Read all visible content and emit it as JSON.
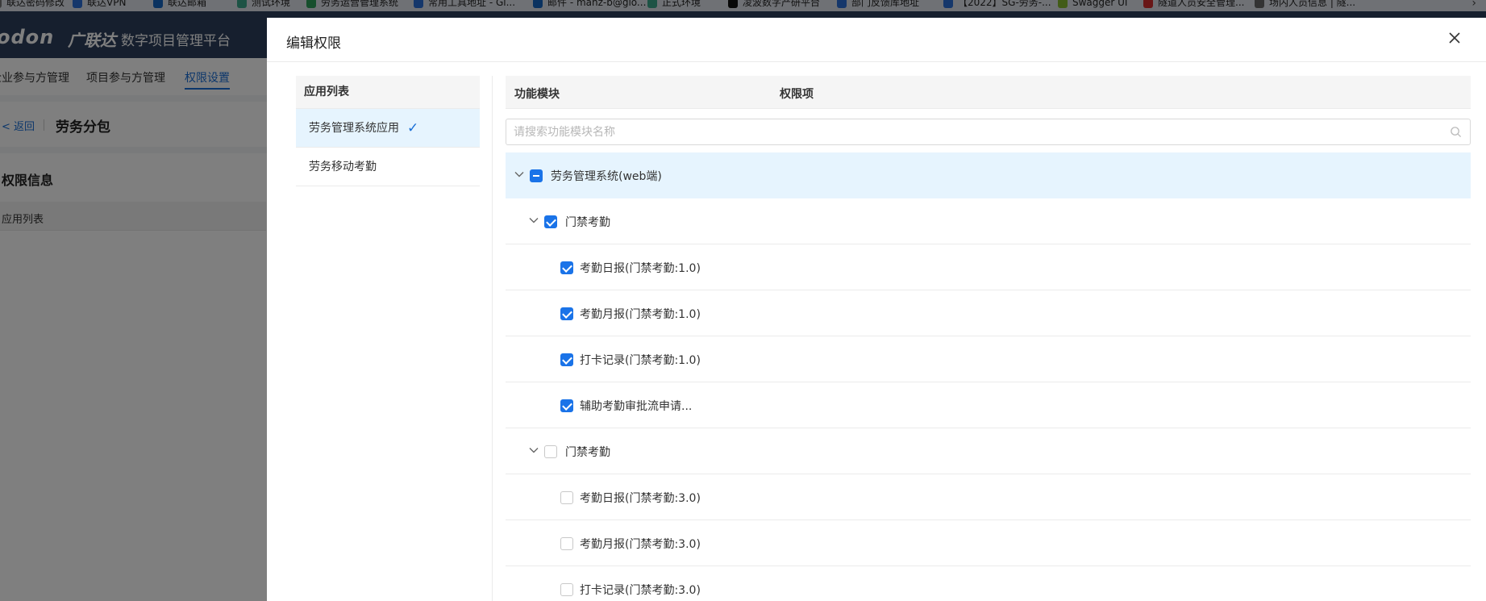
{
  "bookmarks": [
    {
      "label": "联达密码修改",
      "icon": "folder-icon",
      "color": "#777777"
    },
    {
      "label": "联达VPN",
      "icon": "cloud-icon",
      "color": "#2a6fd6"
    },
    {
      "label": "联达邮箱",
      "icon": "mail-icon",
      "color": "#1565c0"
    },
    {
      "label": "测试环境",
      "icon": "grid-icon",
      "color": "#3aa68a"
    },
    {
      "label": "劳务运营管理系统",
      "icon": "leaf-icon",
      "color": "#2e9e5b"
    },
    {
      "label": "常用工具地址 - Gi...",
      "icon": "link-icon",
      "color": "#2a6fd6"
    },
    {
      "label": "邮件 - mahz-b@glo...",
      "icon": "mail-icon",
      "color": "#1565c0"
    },
    {
      "label": "正式环境",
      "icon": "grid-icon",
      "color": "#3aa68a"
    },
    {
      "label": "凌波数字产研平台",
      "icon": "app-icon",
      "color": "#111111"
    },
    {
      "label": "部门反馈库地址",
      "icon": "dropbox-icon",
      "color": "#2a6fd6"
    },
    {
      "label": "【2022】SG-劳务-...",
      "icon": "shield-icon",
      "color": "#2a6fd6"
    },
    {
      "label": "Swagger UI",
      "icon": "swagger-icon",
      "color": "#85b92e"
    },
    {
      "label": "隧道人员安全管理...",
      "icon": "circle-icon",
      "color": "#d32f2f"
    },
    {
      "label": "场内人员信息 | 隧...",
      "icon": "doc-icon",
      "color": "#666666"
    }
  ],
  "app": {
    "logo": "odon",
    "logo_cn": "广联达",
    "platform": "数字项目管理平台",
    "nav": [
      "企业参与方管理",
      "项目参与方管理",
      "权限设置"
    ],
    "back_label": "< 返回",
    "page_title": "劳务分包",
    "section_title": "权限信息",
    "table_header": "应用列表"
  },
  "drawer": {
    "title": "编辑权限",
    "left_header": "应用列表",
    "apps": [
      {
        "label": "劳务管理系统应用",
        "selected": true
      },
      {
        "label": "劳务移动考勤",
        "selected": false
      }
    ],
    "col_module": "功能模块",
    "col_permission": "权限项",
    "search_placeholder": "请搜索功能模块名称",
    "tree": [
      {
        "label": "劳务管理系统(web端)",
        "level": 0,
        "expandable": true,
        "state": "indeterminate"
      },
      {
        "label": "门禁考勤",
        "level": 1,
        "expandable": true,
        "state": "checked"
      },
      {
        "label": "考勤日报(门禁考勤:1.0)",
        "level": 2,
        "expandable": false,
        "state": "checked"
      },
      {
        "label": "考勤月报(门禁考勤:1.0)",
        "level": 2,
        "expandable": false,
        "state": "checked"
      },
      {
        "label": "打卡记录(门禁考勤:1.0)",
        "level": 2,
        "expandable": false,
        "state": "checked"
      },
      {
        "label": "辅助考勤审批流申请...",
        "level": 2,
        "expandable": false,
        "state": "checked"
      },
      {
        "label": "门禁考勤",
        "level": 1,
        "expandable": true,
        "state": "unchecked"
      },
      {
        "label": "考勤日报(门禁考勤:3.0)",
        "level": 2,
        "expandable": false,
        "state": "unchecked"
      },
      {
        "label": "考勤月报(门禁考勤:3.0)",
        "level": 2,
        "expandable": false,
        "state": "unchecked"
      },
      {
        "label": "打卡记录(门禁考勤:3.0)",
        "level": 2,
        "expandable": false,
        "state": "unchecked"
      }
    ]
  },
  "colors": {
    "accent": "#1a73e8",
    "selected_bg": "#e6f4fe",
    "header_bg": "#2c3e5c"
  }
}
